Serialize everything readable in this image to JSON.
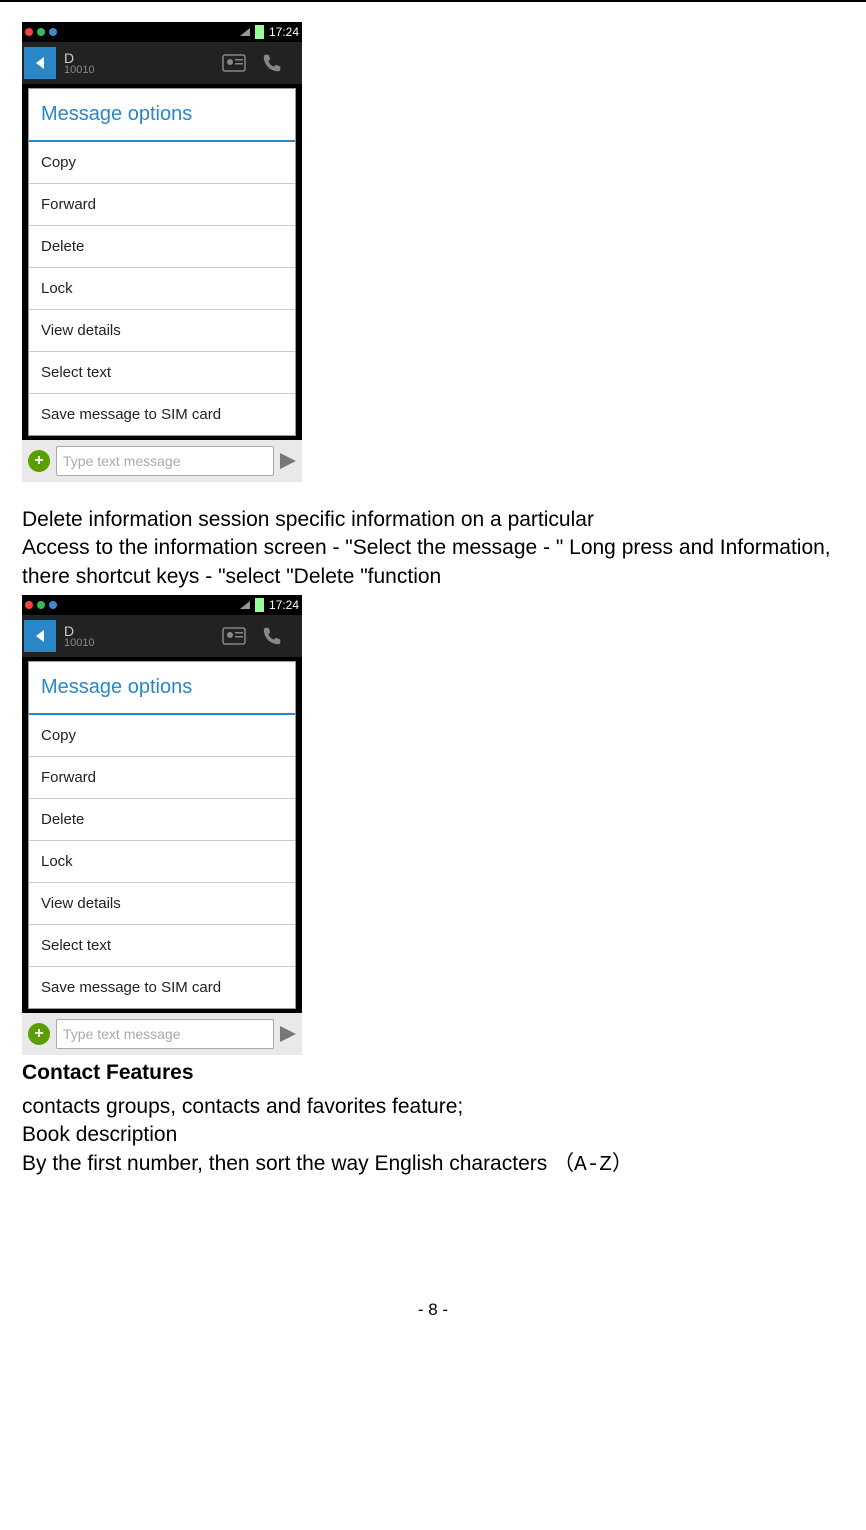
{
  "screenshot": {
    "statusbar": {
      "time": "17:24"
    },
    "topbar": {
      "contact_name": "D",
      "contact_number": "10010"
    },
    "modal_title": "Message options",
    "options": [
      "Copy",
      "Forward",
      "Delete",
      "Lock",
      "View details",
      "Select text",
      "Save message to SIM card"
    ],
    "composer": {
      "placeholder": "Type text message"
    }
  },
  "paragraphs": {
    "p1": "Delete information session specific information on a particular",
    "p2": "Access to the information screen - \"Select the message - \" Long press and Information, there shortcut keys - \"select \"Delete \"function"
  },
  "heading": "Contact Features",
  "paragraphs2": {
    "p1": "contacts groups, contacts and favorites feature;",
    "p2": "Book description",
    "p3a": "By the first number, then sort the way English characters  ",
    "p3b": "（A-Z）"
  },
  "page_number": "- 8 -"
}
